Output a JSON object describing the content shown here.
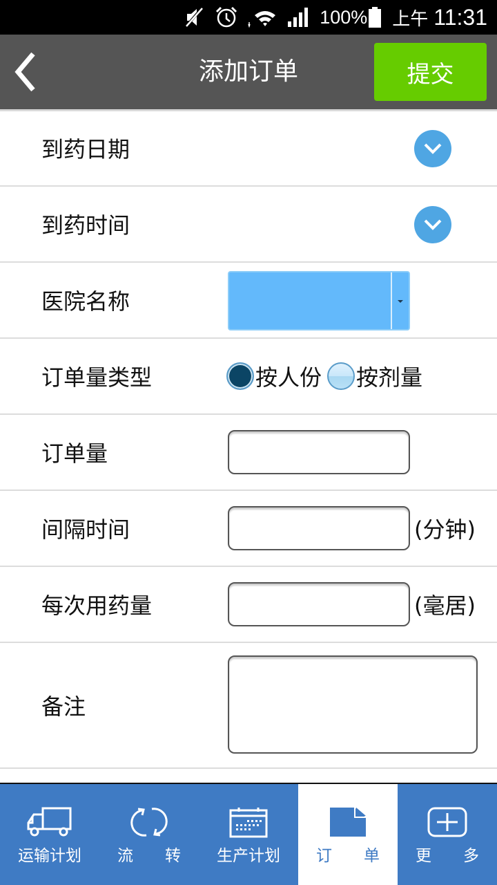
{
  "status_bar": {
    "icons": [
      "mute-icon",
      "alarm-icon",
      "wifi-icon",
      "signal-icon"
    ],
    "battery": "100%",
    "ampm": "上午",
    "time": "11:31"
  },
  "header": {
    "back_icon": "chevron-left-icon",
    "title": "添加订单",
    "submit_label": "提交",
    "submit_color": "#66cc00"
  },
  "form": {
    "arrival_date": {
      "label": "到药日期",
      "icon": "chevron-down-circle-icon"
    },
    "arrival_time": {
      "label": "到药时间",
      "icon": "chevron-down-circle-icon"
    },
    "hospital": {
      "label": "医院名称",
      "value": ""
    },
    "order_type": {
      "label": "订单量类型",
      "options": [
        {
          "label": "按人份",
          "checked": true
        },
        {
          "label": "按剂量",
          "checked": false
        }
      ]
    },
    "order_qty": {
      "label": "订单量",
      "value": ""
    },
    "interval": {
      "label": "间隔时间",
      "value": "",
      "unit": "(分钟)"
    },
    "dose": {
      "label": "每次用药量",
      "value": "",
      "unit": "(毫居)"
    },
    "remark": {
      "label": "备注",
      "value": ""
    }
  },
  "tabbar": {
    "accent": "#3f7bc4",
    "tabs": [
      {
        "icon": "truck-icon",
        "label": "运输计划",
        "active": false
      },
      {
        "icon": "refresh-icon",
        "label_a": "流",
        "label_b": "转",
        "active": false
      },
      {
        "icon": "calendar-icon",
        "label": "生产计划",
        "active": false
      },
      {
        "icon": "document-icon",
        "label_a": "订",
        "label_b": "单",
        "active": true
      },
      {
        "icon": "plus-box-icon",
        "label_a": "更",
        "label_b": "多",
        "active": false
      }
    ]
  }
}
